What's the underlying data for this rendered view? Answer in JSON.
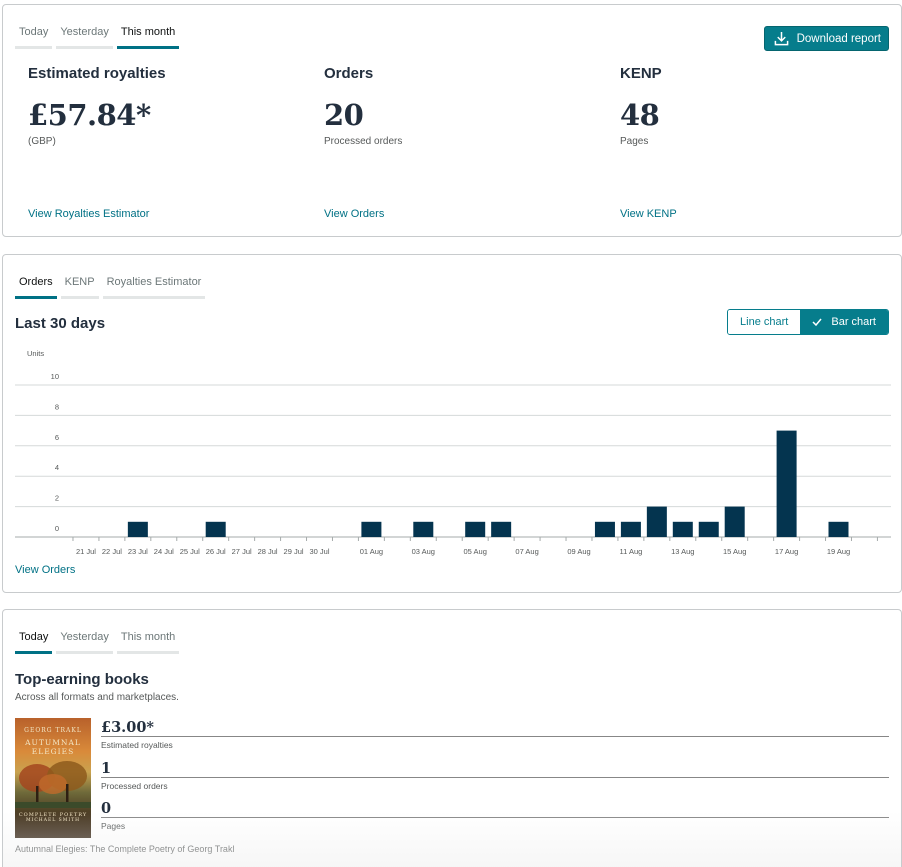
{
  "summary": {
    "tabs": [
      "Today",
      "Yesterday",
      "This month"
    ],
    "download_label": "Download report",
    "metrics": [
      {
        "title": "Estimated royalties",
        "value": "£57.84*",
        "sub": "(GBP)",
        "link": "View Royalties Estimator"
      },
      {
        "title": "Orders",
        "value": "20",
        "sub": "Processed orders",
        "link": "View Orders"
      },
      {
        "title": "KENP",
        "value": "48",
        "sub": "Pages",
        "link": "View KENP"
      }
    ]
  },
  "chart_panel": {
    "tabs": [
      "Orders",
      "KENP",
      "Royalties Estimator"
    ],
    "title": "Last 30 days",
    "toggle_line": "Line chart",
    "toggle_bar": "Bar chart",
    "view_link": "View Orders"
  },
  "chart_data": {
    "type": "bar",
    "ylabel": "Units",
    "ylim": [
      0,
      10
    ],
    "yticks": [
      0,
      2,
      4,
      6,
      8,
      10
    ],
    "categories": [
      "20 Jul",
      "21 Jul",
      "22 Jul",
      "23 Jul",
      "24 Jul",
      "25 Jul",
      "26 Jul",
      "27 Jul",
      "28 Jul",
      "29 Jul",
      "30 Jul",
      "31 Jul",
      "01 Aug",
      "02 Aug",
      "03 Aug",
      "04 Aug",
      "05 Aug",
      "06 Aug",
      "07 Aug",
      "08 Aug",
      "09 Aug",
      "10 Aug",
      "11 Aug",
      "12 Aug",
      "13 Aug",
      "14 Aug",
      "15 Aug",
      "16 Aug",
      "17 Aug",
      "18 Aug",
      "19 Aug",
      "20 Aug"
    ],
    "tick_labels": [
      "",
      "21 Jul",
      "22 Jul",
      "23 Jul",
      "24 Jul",
      "25 Jul",
      "26 Jul",
      "27 Jul",
      "28 Jul",
      "29 Jul",
      "30 Jul",
      "",
      "01 Aug",
      "",
      "03 Aug",
      "",
      "05 Aug",
      "",
      "07 Aug",
      "",
      "09 Aug",
      "",
      "11 Aug",
      "",
      "13 Aug",
      "",
      "15 Aug",
      "",
      "17 Aug",
      "",
      "19 Aug",
      ""
    ],
    "values": [
      0,
      0,
      0,
      1,
      0,
      0,
      1,
      0,
      0,
      0,
      0,
      0,
      1,
      0,
      1,
      0,
      1,
      1,
      0,
      0,
      0,
      1,
      1,
      2,
      1,
      1,
      2,
      0,
      7,
      0,
      1,
      0
    ],
    "bar_color": "#04344f",
    "grid": true
  },
  "top_books": {
    "tabs": [
      "Today",
      "Yesterday",
      "This month"
    ],
    "title": "Top-earning books",
    "subtitle": "Across all formats and marketplaces.",
    "book": {
      "cover_author": "GEORG TRAKL",
      "cover_title_1": "AUTUMNAL",
      "cover_title_2": "ELEGIES",
      "cover_sub": "COMPLETE POETRY",
      "cover_translator": "MICHAEL SMITH",
      "royalties": "£3.00*",
      "royalties_label": "Estimated royalties",
      "orders": "1",
      "orders_label": "Processed orders",
      "pages": "0",
      "pages_label": "Pages",
      "name": "Autumnal Elegies: The Complete Poetry of Georg Trakl"
    }
  },
  "colors": {
    "accent": "#067d8c",
    "link": "#007185",
    "bar": "#04344f"
  }
}
